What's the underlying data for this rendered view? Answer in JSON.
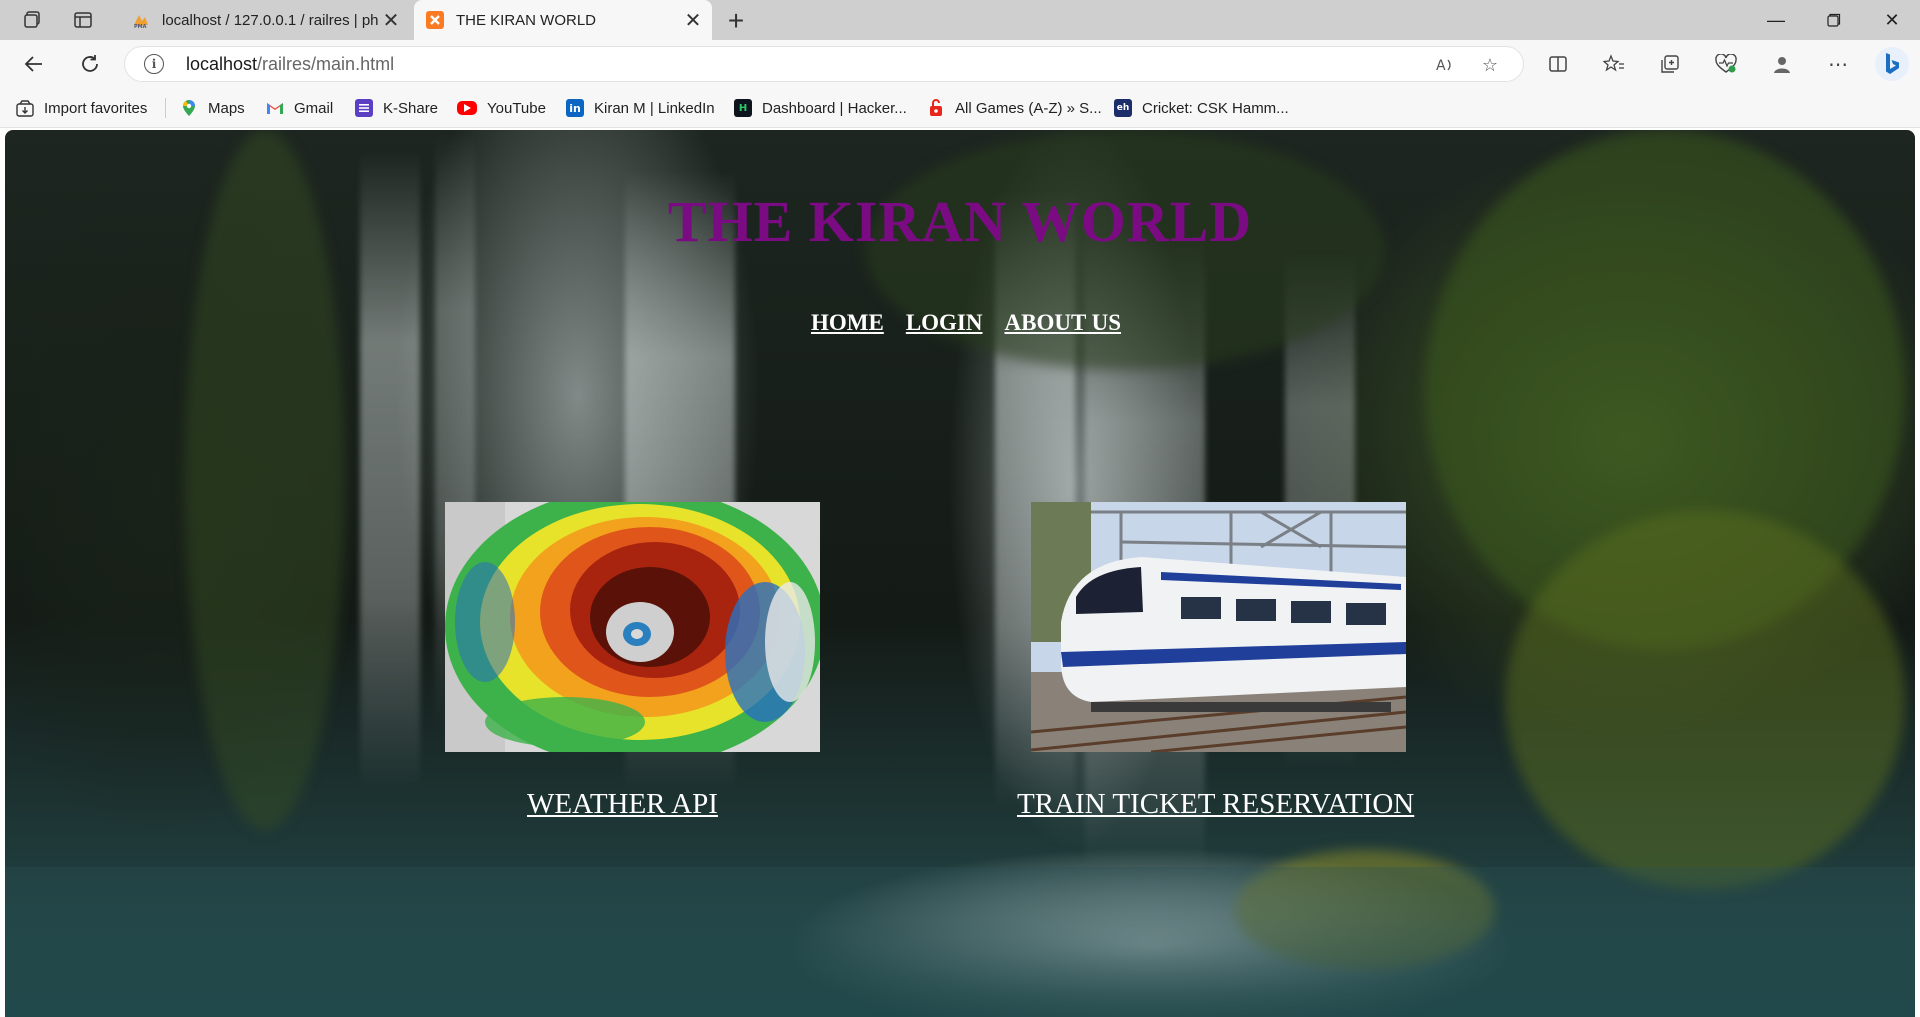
{
  "browser": {
    "tabs": [
      {
        "label": "localhost / 127.0.0.1 / railres | ph",
        "favicon": "phpmyadmin-icon",
        "active": false
      },
      {
        "label": "THE KIRAN WORLD",
        "favicon": "xampp-icon",
        "active": true
      }
    ],
    "address": {
      "host": "localhost",
      "path": "/railres/main.html"
    },
    "bookmarks": [
      {
        "label": "Import favorites",
        "icon": "import-icon"
      },
      {
        "label": "Maps",
        "icon": "maps-icon"
      },
      {
        "label": "Gmail",
        "icon": "gmail-icon"
      },
      {
        "label": "K-Share",
        "icon": "kshare-icon"
      },
      {
        "label": "YouTube",
        "icon": "youtube-icon"
      },
      {
        "label": "Kiran M | LinkedIn",
        "icon": "linkedin-icon"
      },
      {
        "label": "Dashboard | Hacker...",
        "icon": "hackerrank-icon"
      },
      {
        "label": "All Games (A-Z) » S...",
        "icon": "games-icon"
      },
      {
        "label": "Cricket: CSK Hamm...",
        "icon": "cricket-icon"
      }
    ]
  },
  "page": {
    "title": "THE KIRAN WORLD",
    "title_color": "#7b0b82",
    "nav": [
      {
        "label": "HOME"
      },
      {
        "label": "LOGIN"
      },
      {
        "label": "ABOUT US"
      }
    ],
    "cards": [
      {
        "label": "WEATHER API",
        "image": "cyclone-satellite-image"
      },
      {
        "label": "TRAIN TICKET RESERVATION",
        "image": "vande-bharat-train-image"
      }
    ]
  }
}
